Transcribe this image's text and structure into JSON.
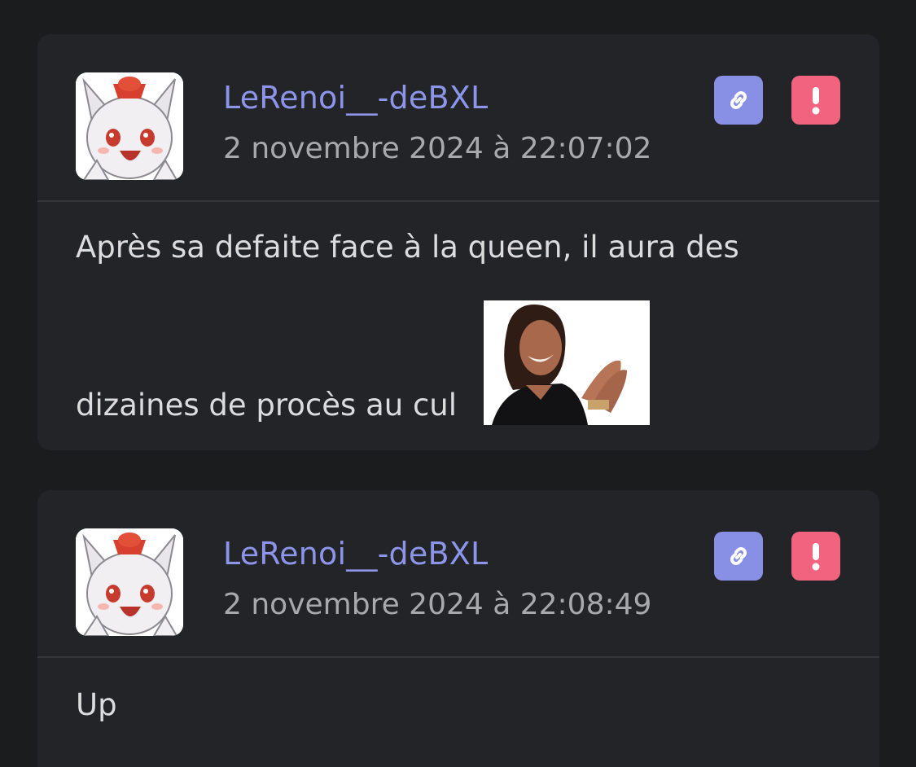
{
  "posts": [
    {
      "username": "LeRenoi__-deBXL",
      "date": "2 novembre 2024 à 22:07:02",
      "message_line1": "Après sa defaite face à la queen, il aura des",
      "message_line2": "dizaines de procès au cul",
      "link_icon": "link-icon",
      "report_icon": "exclamation-icon"
    },
    {
      "username": "LeRenoi__-deBXL",
      "date": "2 novembre 2024 à 22:08:49",
      "message_line1": "Up",
      "link_icon": "link-icon",
      "report_icon": "exclamation-icon"
    }
  ],
  "colors": {
    "background": "#1b1c1e",
    "card": "#232427",
    "username": "#8d95ea",
    "link_button": "#8890e6",
    "report_button": "#f2637f"
  }
}
